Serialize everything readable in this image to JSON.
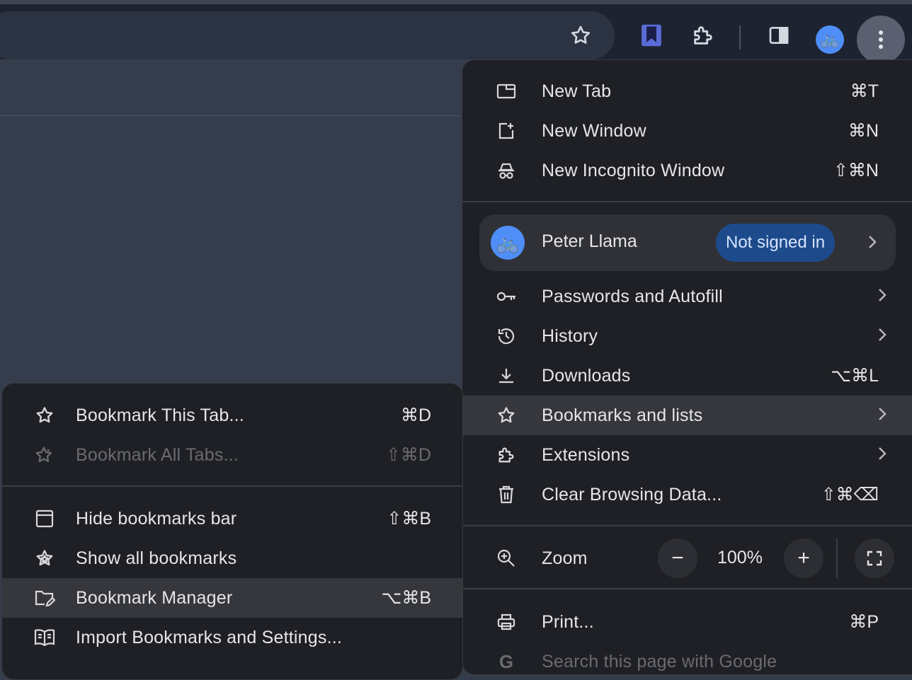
{
  "main_menu": {
    "items": [
      {
        "label": "New Tab",
        "shortcut": "⌘T",
        "icon": "new-tab-icon"
      },
      {
        "label": "New Window",
        "shortcut": "⌘N",
        "icon": "new-window-icon"
      },
      {
        "label": "New Incognito Window",
        "shortcut": "⇧⌘N",
        "icon": "incognito-icon"
      }
    ],
    "profile": {
      "name": "Peter Llama",
      "status": "Not signed in"
    },
    "items2": [
      {
        "label": "Passwords and Autofill",
        "icon": "key-icon"
      },
      {
        "label": "History",
        "icon": "history-icon"
      },
      {
        "label": "Downloads",
        "shortcut": "⌥⌘L",
        "icon": "download-icon"
      },
      {
        "label": "Bookmarks and lists",
        "icon": "star-icon"
      },
      {
        "label": "Extensions",
        "icon": "extension-icon"
      },
      {
        "label": "Clear Browsing Data...",
        "shortcut": "⇧⌘⌫",
        "icon": "trash-icon"
      }
    ],
    "zoom": {
      "label": "Zoom",
      "minus": "−",
      "value": "100%",
      "plus": "+"
    },
    "print": {
      "label": "Print...",
      "shortcut": "⌘P"
    },
    "search_page": {
      "label": "Search this page with Google"
    }
  },
  "bookmarks_submenu": {
    "items": [
      {
        "label": "Bookmark This Tab...",
        "shortcut": "⌘D"
      },
      {
        "label": "Bookmark All Tabs...",
        "shortcut": "⇧⌘D",
        "disabled": true
      },
      {
        "label": "Hide bookmarks bar",
        "shortcut": "⇧⌘B"
      },
      {
        "label": "Show all bookmarks",
        "shortcut": ""
      },
      {
        "label": "Bookmark Manager",
        "shortcut": "⌥⌘B"
      },
      {
        "label": "Import Bookmarks and Settings...",
        "shortcut": ""
      }
    ]
  },
  "colors": {
    "accent": "#4f8ef7",
    "menu_bg": "#1f2025",
    "badge_bg": "#1c4a8a"
  }
}
